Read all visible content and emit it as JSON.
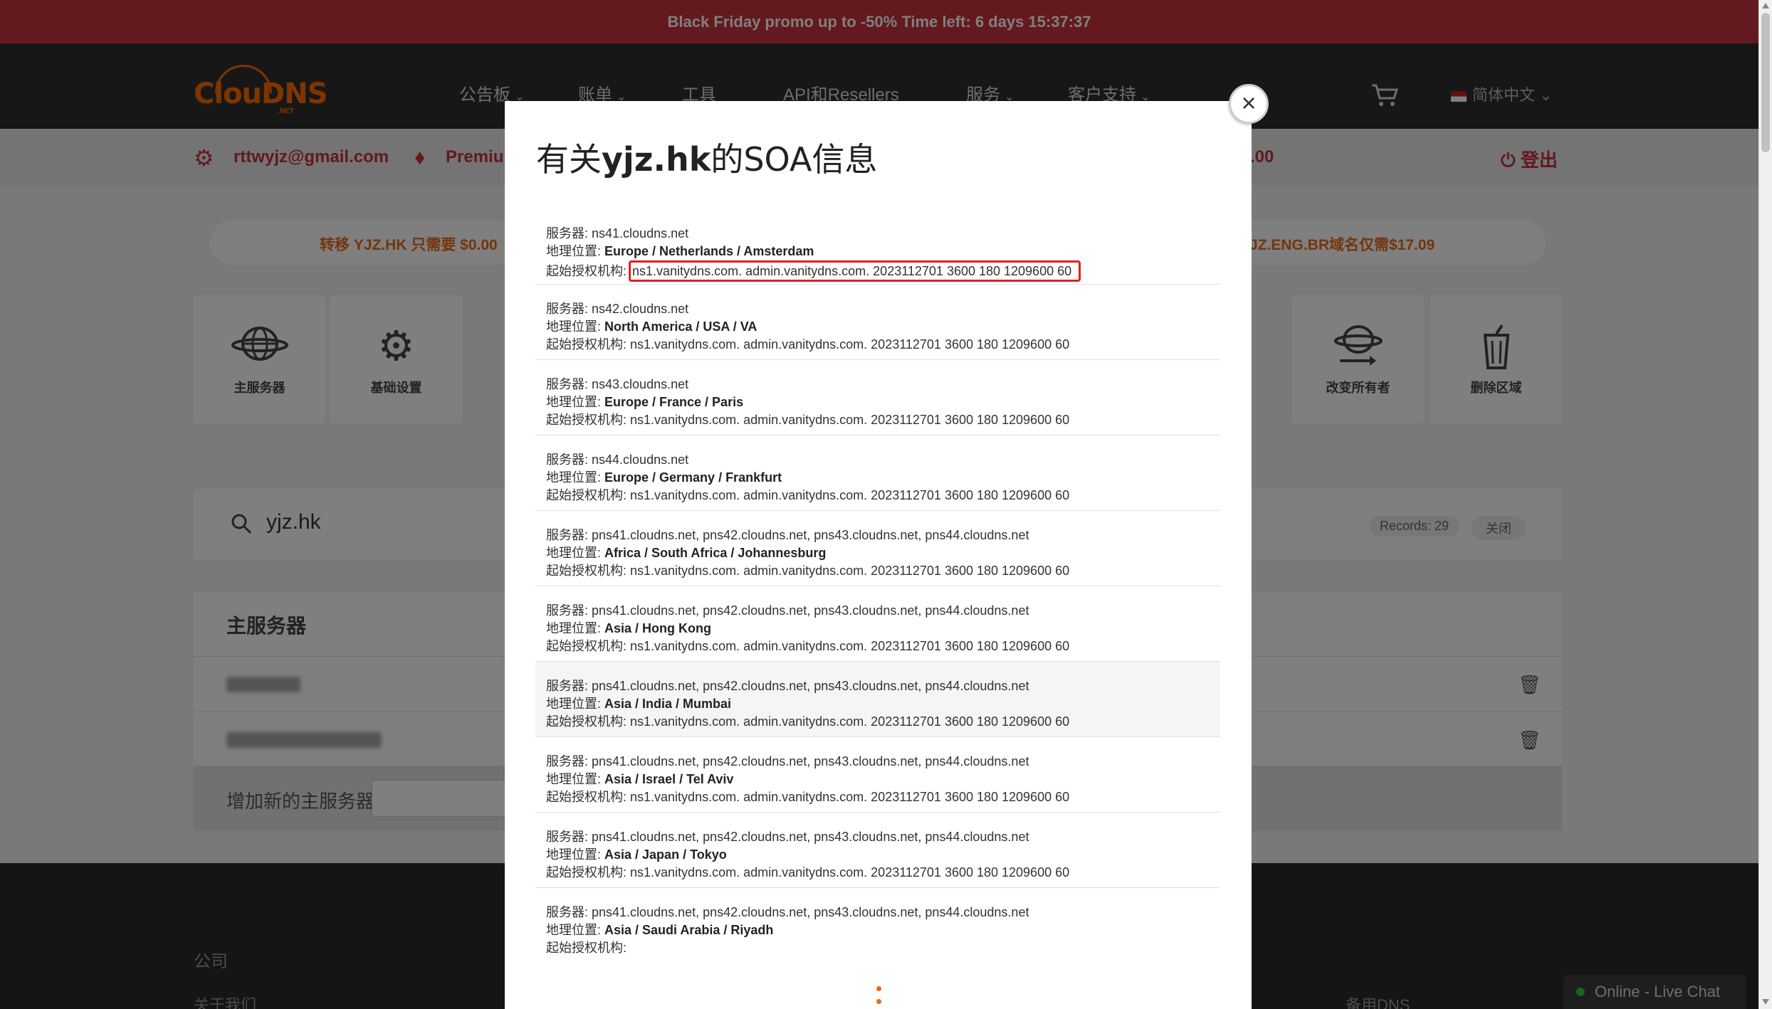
{
  "promo": {
    "text": "Black Friday promo up to -50% Time left: 6 days 15:37:37"
  },
  "brand": {
    "logo_text": "ClouDNS",
    "logo_suffix": ".NET"
  },
  "nav": {
    "items": [
      {
        "label": "公告板",
        "has_dropdown": true
      },
      {
        "label": "账单",
        "has_dropdown": true
      },
      {
        "label": "工具",
        "has_dropdown": false
      },
      {
        "label": "API和Resellers",
        "has_dropdown": false
      },
      {
        "label": "服务",
        "has_dropdown": true
      },
      {
        "label": "客户支持",
        "has_dropdown": true
      }
    ],
    "language": "简体中文"
  },
  "account": {
    "email": "rttwyjz@gmail.com",
    "plan": "Premiu",
    "balance": ".00",
    "logout": "登出"
  },
  "offers": {
    "left": "转移 YJZ.HK 只需要 $0.00",
    "right": "JZ.ENG.BR域名仅需$17.09"
  },
  "tiles": [
    {
      "label": "主服务器",
      "icon": "globe-servers-icon"
    },
    {
      "label": "基础设置",
      "icon": "gear-icon"
    },
    {
      "label": "改变所有者",
      "icon": "globe-transfer-icon"
    },
    {
      "label": "删除区域",
      "icon": "trash-icon"
    }
  ],
  "zone": {
    "name": "yjz.hk",
    "records": "Records: 29",
    "close": "关闭"
  },
  "master_servers": {
    "title": "主服务器",
    "add_label": "增加新的主服务器:"
  },
  "footer": {
    "company": "公司",
    "about": "关于我们",
    "backup_dns": "备用DNS"
  },
  "livechat": {
    "label": "Online - Live Chat"
  },
  "modal": {
    "title_prefix": "有关",
    "title_domain": "yjz.hk",
    "title_suffix": "的SOA信息",
    "labels": {
      "server": "服务器: ",
      "location": "地理位置: ",
      "soa": "起始授权机构: "
    },
    "entries": [
      {
        "server": "ns41.cloudns.net",
        "location": "Europe / Netherlands / Amsterdam",
        "soa": "ns1.vanitydns.com. admin.vanitydns.com. 2023112701 3600 180 1209600 60"
      },
      {
        "server": "ns42.cloudns.net",
        "location": "North America / USA / VA",
        "soa": "ns1.vanitydns.com. admin.vanitydns.com. 2023112701 3600 180 1209600 60"
      },
      {
        "server": "ns43.cloudns.net",
        "location": "Europe / France / Paris",
        "soa": "ns1.vanitydns.com. admin.vanitydns.com. 2023112701 3600 180 1209600 60"
      },
      {
        "server": "ns44.cloudns.net",
        "location": "Europe / Germany / Frankfurt",
        "soa": "ns1.vanitydns.com. admin.vanitydns.com. 2023112701 3600 180 1209600 60"
      },
      {
        "server": "pns41.cloudns.net, pns42.cloudns.net, pns43.cloudns.net, pns44.cloudns.net",
        "location": "Africa / South Africa / Johannesburg",
        "soa": "ns1.vanitydns.com. admin.vanitydns.com. 2023112701 3600 180 1209600 60"
      },
      {
        "server": "pns41.cloudns.net, pns42.cloudns.net, pns43.cloudns.net, pns44.cloudns.net",
        "location": "Asia / Hong Kong",
        "soa": "ns1.vanitydns.com. admin.vanitydns.com. 2023112701 3600 180 1209600 60"
      },
      {
        "server": "pns41.cloudns.net, pns42.cloudns.net, pns43.cloudns.net, pns44.cloudns.net",
        "location": "Asia / India / Mumbai",
        "soa": "ns1.vanitydns.com. admin.vanitydns.com. 2023112701 3600 180 1209600 60"
      },
      {
        "server": "pns41.cloudns.net, pns42.cloudns.net, pns43.cloudns.net, pns44.cloudns.net",
        "location": "Asia / Israel / Tel Aviv",
        "soa": "ns1.vanitydns.com. admin.vanitydns.com. 2023112701 3600 180 1209600 60"
      },
      {
        "server": "pns41.cloudns.net, pns42.cloudns.net, pns43.cloudns.net, pns44.cloudns.net",
        "location": "Asia / Japan / Tokyo",
        "soa": "ns1.vanitydns.com. admin.vanitydns.com. 2023112701 3600 180 1209600 60"
      },
      {
        "server": "pns41.cloudns.net, pns42.cloudns.net, pns43.cloudns.net, pns44.cloudns.net",
        "location": "Asia / Saudi Arabia / Riyadh",
        "soa": ""
      }
    ],
    "highlighted_entry_index": 6,
    "boxed_soa_index": 0
  },
  "colors": {
    "promo_bg": "#c7323a",
    "nav_bg": "#2e2e2e",
    "accent": "#c7323a",
    "orange": "#e86a1a",
    "highlight_box": "#e02020"
  }
}
